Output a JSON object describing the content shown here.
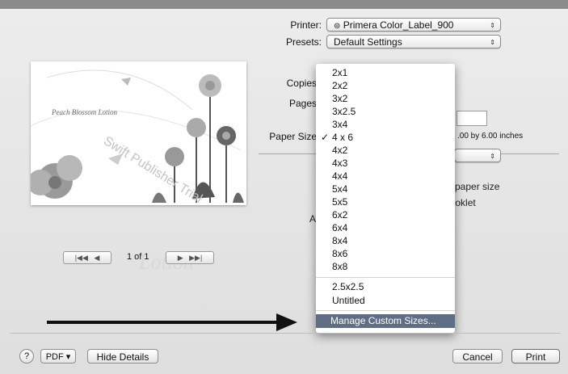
{
  "printer": {
    "label": "Printer:",
    "value": "Primera Color_Label_900"
  },
  "presets": {
    "label": "Presets:",
    "value": "Default Settings"
  },
  "copies_label": "Copies",
  "pages_label": "Pages",
  "paper_size": {
    "label": "Paper Size",
    "detail": ".00 by 6.00 inches"
  },
  "preview": {
    "text1": "Peach Blossom Lotion",
    "text2": "Swift Publisher Trial"
  },
  "ghost": {
    "scale": "paper size",
    "booklet": "booklet",
    "bg_word": "Lotion",
    "app_partial": "A"
  },
  "page_nav": {
    "first": "|◀◀",
    "prev": "◀",
    "indicator": "1 of 1",
    "next": "▶",
    "last": "▶▶|"
  },
  "paper_size_menu": {
    "items": [
      "2x1",
      "2x2",
      "3x2",
      "3x2.5",
      "3x4",
      "4 x 6",
      "4x2",
      "4x3",
      "4x4",
      "5x4",
      "5x5",
      "6x2",
      "6x4",
      "8x4",
      "8x6",
      "8x8"
    ],
    "selected": "4 x 6",
    "checkmark": "✓",
    "extra_items": [
      "2.5x2.5",
      "Untitled"
    ],
    "manage": "Manage Custom Sizes..."
  },
  "bottom": {
    "help": "?",
    "pdf": "PDF ▾",
    "hide_details": "Hide Details",
    "cancel": "Cancel",
    "print": "Print"
  },
  "colors": {
    "highlight": "#5f6d85",
    "arrow": "#111111"
  }
}
